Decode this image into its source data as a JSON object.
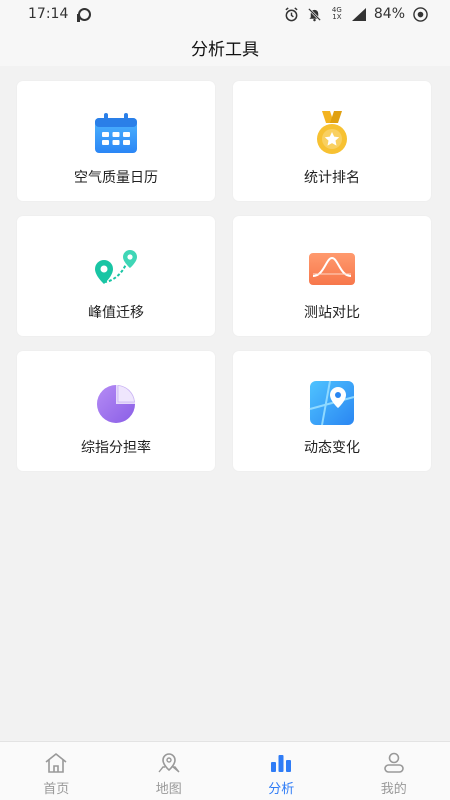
{
  "status_bar": {
    "time": "17:14",
    "network": "4G 1X",
    "battery": "84%"
  },
  "header": {
    "title": "分析工具"
  },
  "tools": [
    {
      "label": "空气质量日历",
      "icon": "calendar-icon"
    },
    {
      "label": "统计排名",
      "icon": "medal-icon"
    },
    {
      "label": "峰值迁移",
      "icon": "location-route-icon"
    },
    {
      "label": "测站对比",
      "icon": "wave-chart-icon"
    },
    {
      "label": "综指分担率",
      "icon": "pie-chart-icon"
    },
    {
      "label": "动态变化",
      "icon": "map-pin-icon"
    }
  ],
  "tabbar": {
    "active": "分析",
    "items": [
      {
        "label": "首页",
        "icon": "home-icon"
      },
      {
        "label": "地图",
        "icon": "map-icon"
      },
      {
        "label": "分析",
        "icon": "bar-chart-icon"
      },
      {
        "label": "我的",
        "icon": "user-icon"
      }
    ]
  },
  "colors": {
    "accent": "#2f7cf6",
    "background": "#f2f2f2",
    "card": "#ffffff"
  }
}
